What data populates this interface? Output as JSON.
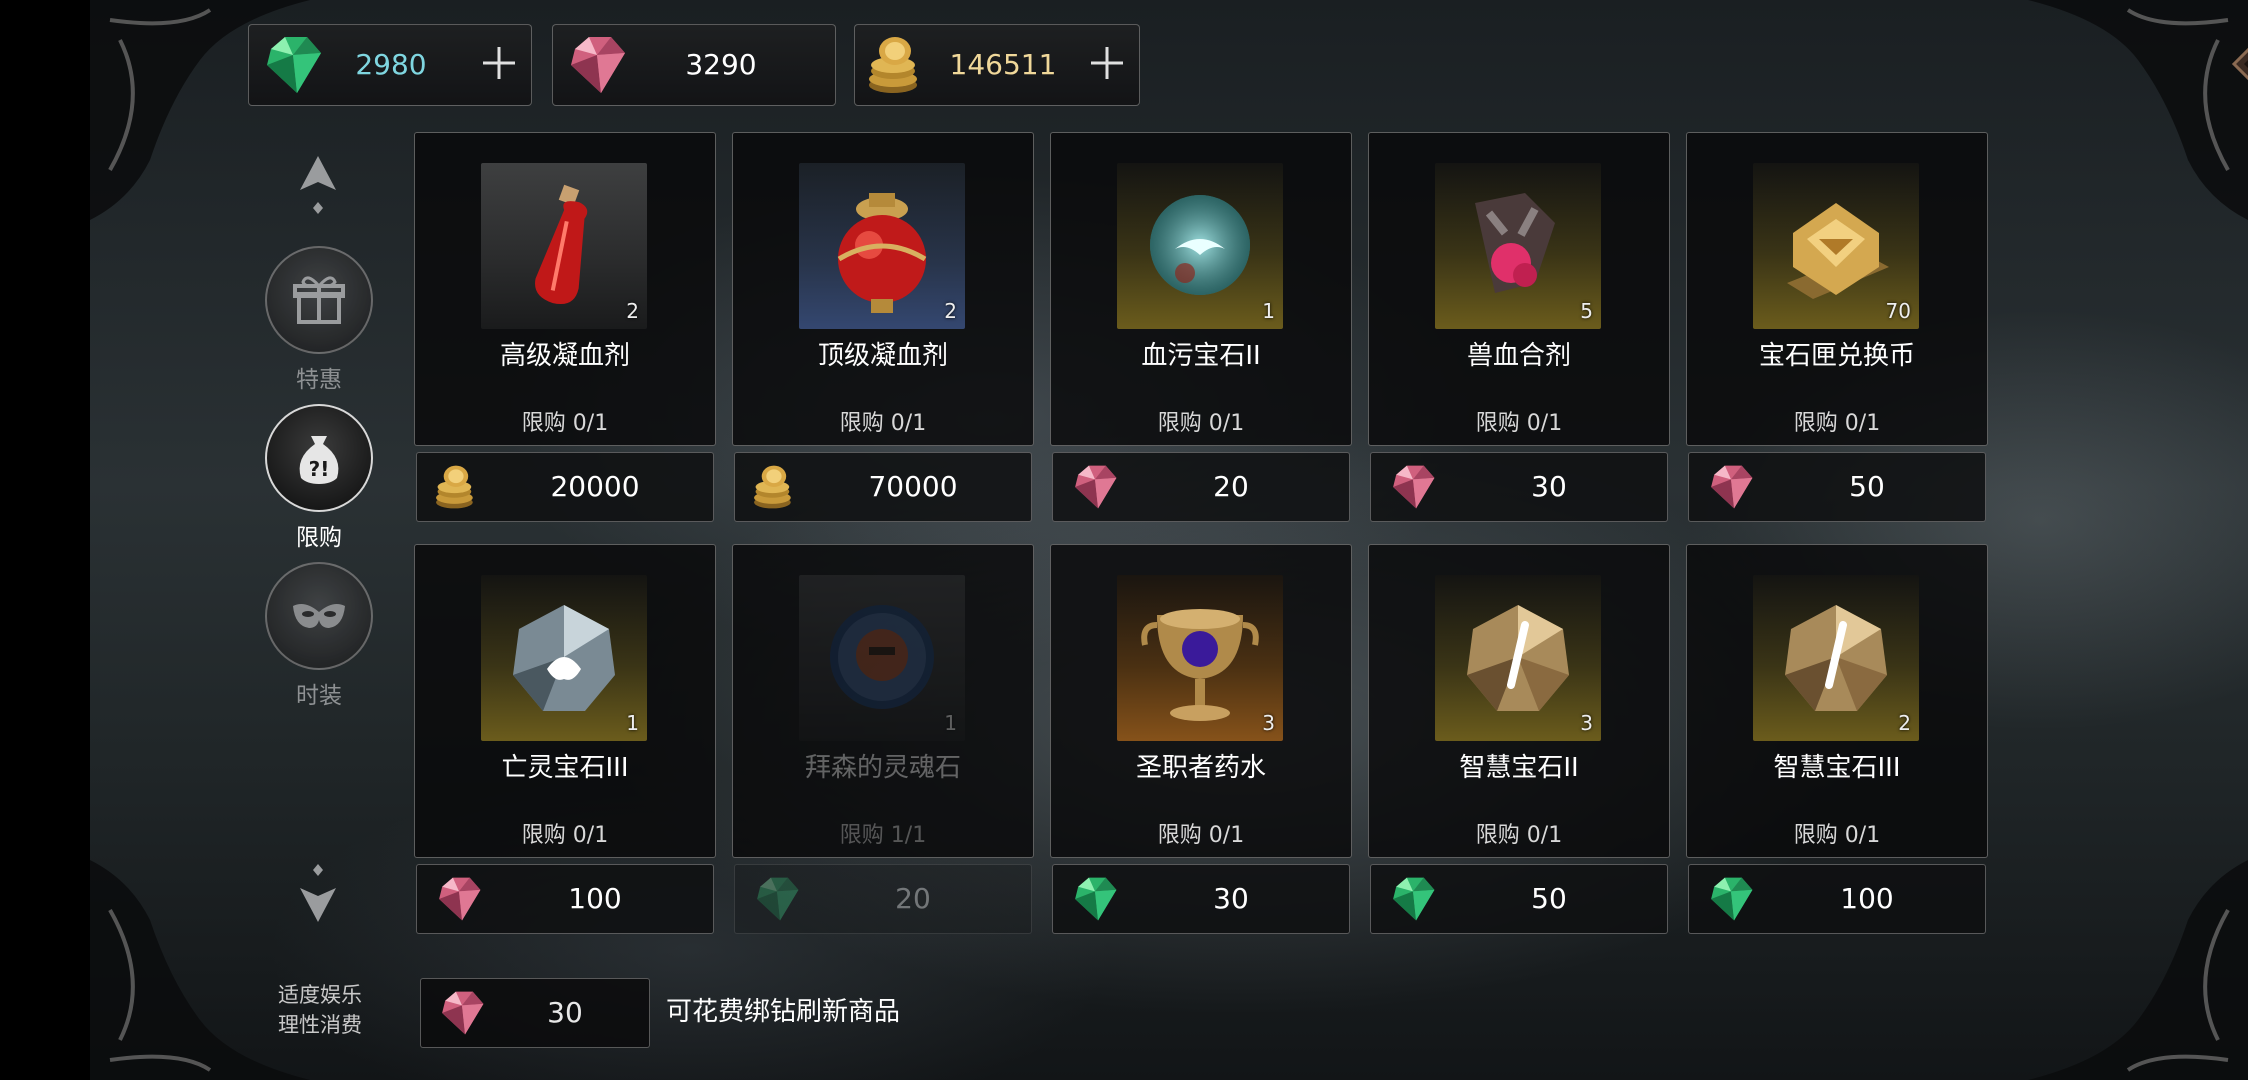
{
  "currencies": [
    {
      "icon": "green-diamond-icon",
      "value": "2980",
      "color": "#7fd6e0",
      "has_plus": true
    },
    {
      "icon": "pink-diamond-icon",
      "value": "3290",
      "color": "#ffffff",
      "has_plus": false
    },
    {
      "icon": "gold-coin-icon",
      "value": "146511",
      "color": "#f0d89a",
      "has_plus": true
    }
  ],
  "nav": {
    "items": [
      {
        "id": "special",
        "label": "特惠",
        "icon": "gift-icon",
        "active": false
      },
      {
        "id": "limited",
        "label": "限购",
        "icon": "mystery-bag-icon",
        "active": true
      },
      {
        "id": "fashion",
        "label": "时装",
        "icon": "mask-icon",
        "active": false
      }
    ],
    "disclaimer_line1": "适度娱乐",
    "disclaimer_line2": "理性消费"
  },
  "items": [
    {
      "name": "高级凝血剂",
      "count": "2",
      "limit": "限购 0/1",
      "price": "20000",
      "currency": "gold-coin-icon",
      "thumb_style": "gray",
      "art": "potion-bottle-icon",
      "dim": false
    },
    {
      "name": "顶级凝血剂",
      "count": "2",
      "limit": "限购 0/1",
      "price": "70000",
      "currency": "gold-coin-icon",
      "thumb_style": "blue",
      "art": "potion-jar-icon",
      "dim": false
    },
    {
      "name": "血污宝石II",
      "count": "1",
      "limit": "限购 0/1",
      "price": "20",
      "currency": "pink-diamond-icon",
      "thumb_style": "gold",
      "art": "blood-gem-icon",
      "dim": false
    },
    {
      "name": "兽血合剂",
      "count": "5",
      "limit": "限购 0/1",
      "price": "30",
      "currency": "pink-diamond-icon",
      "thumb_style": "gold",
      "art": "beast-blood-icon",
      "dim": false
    },
    {
      "name": "宝石匣兑换币",
      "count": "70",
      "limit": "限购 0/1",
      "price": "50",
      "currency": "pink-diamond-icon",
      "thumb_style": "gold",
      "art": "gem-token-icon",
      "dim": false
    },
    {
      "name": "亡灵宝石III",
      "count": "1",
      "limit": "限购 0/1",
      "price": "100",
      "currency": "pink-diamond-icon",
      "thumb_style": "gold",
      "art": "undead-gem-icon",
      "dim": false
    },
    {
      "name": "拜森的灵魂石",
      "count": "1",
      "limit": "限购 1/1",
      "price": "20",
      "currency": "green-diamond-icon",
      "thumb_style": "gray",
      "art": "soul-stone-icon",
      "dim": true
    },
    {
      "name": "圣职者药水",
      "count": "3",
      "limit": "限购 0/1",
      "price": "30",
      "currency": "green-diamond-icon",
      "thumb_style": "amber",
      "art": "chalice-icon",
      "dim": false
    },
    {
      "name": "智慧宝石II",
      "count": "3",
      "limit": "限购 0/1",
      "price": "50",
      "currency": "green-diamond-icon",
      "thumb_style": "gold",
      "art": "wisdom-gem-icon",
      "dim": false
    },
    {
      "name": "智慧宝石III",
      "count": "2",
      "limit": "限购 0/1",
      "price": "100",
      "currency": "green-diamond-icon",
      "thumb_style": "gold",
      "art": "wisdom-gem-icon",
      "dim": false
    }
  ],
  "refresh": {
    "price": "30",
    "currency": "pink-diamond-icon",
    "text": "可花费绑钻刷新商品"
  }
}
